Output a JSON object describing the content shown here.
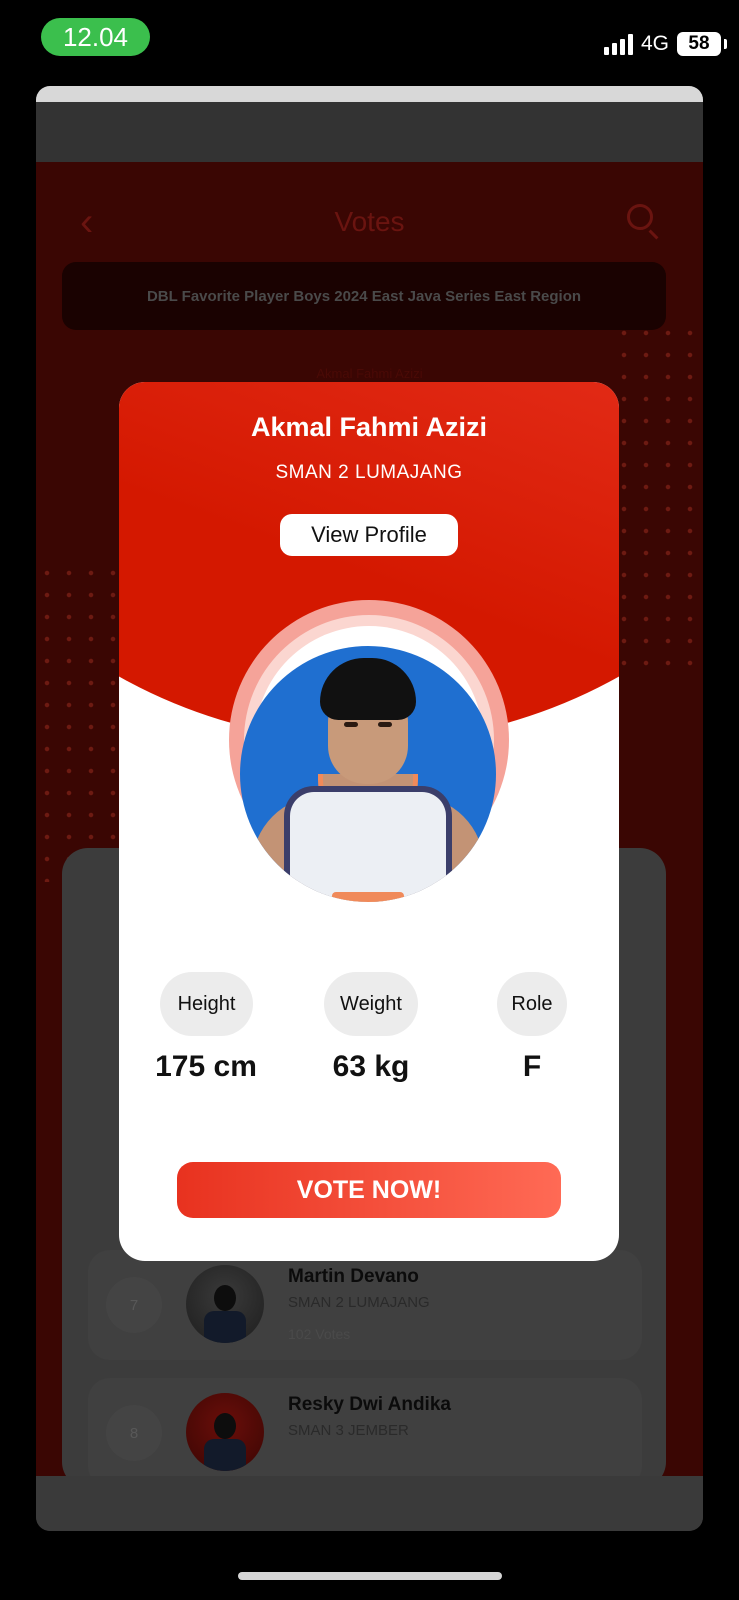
{
  "status_bar": {
    "time": "12.04",
    "network": "4G",
    "battery": "58"
  },
  "header": {
    "back_icon": "chevron-left-icon",
    "title": "Votes",
    "search_icon": "search-icon"
  },
  "event": {
    "banner": "DBL Favorite Player Boys 2024 East Java Series East Region"
  },
  "background_player_name": "Akmal Fahmi Azizi",
  "modal": {
    "name": "Akmal Fahmi Azizi",
    "school": "SMAN 2 LUMAJANG",
    "view_profile_label": "View Profile",
    "stats": [
      {
        "label": "Height",
        "value": "175 cm"
      },
      {
        "label": "Weight",
        "value": "63 kg"
      },
      {
        "label": "Role",
        "value": "F"
      }
    ],
    "vote_label": "VOTE NOW!"
  },
  "list": {
    "items": [
      {
        "rank": "7",
        "name": "Martin Devano",
        "school": "SMAN 2 LUMAJANG",
        "votes": "102 Votes"
      },
      {
        "rank": "8",
        "name": "Resky Dwi Andika",
        "school": "SMAN 3 JEMBER",
        "votes": ""
      }
    ]
  },
  "colors": {
    "accent": "#e8321f",
    "accent_light": "#ff6a55",
    "status_green": "#3bbf4d"
  }
}
